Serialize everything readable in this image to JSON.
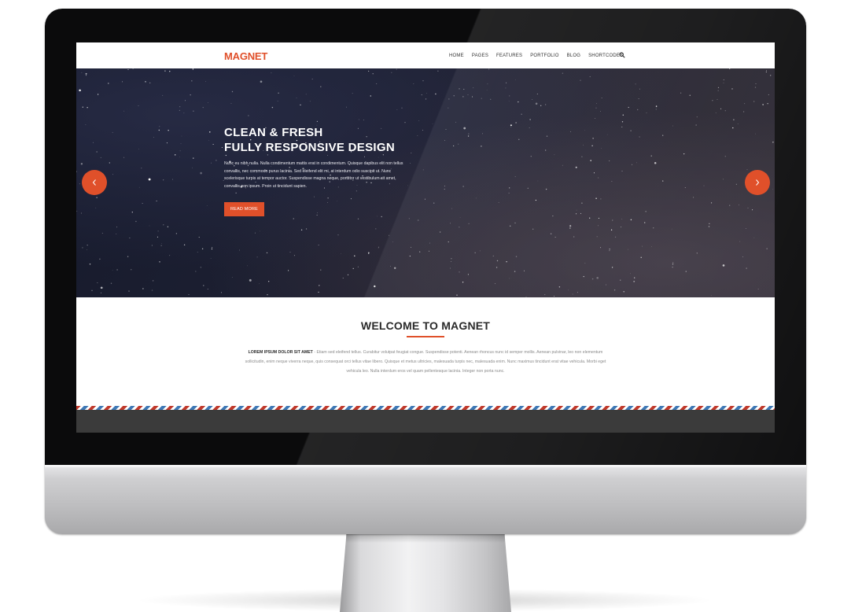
{
  "nav": {
    "logo": "MAGNET",
    "items": [
      "HOME",
      "PAGES",
      "FEATURES",
      "PORTFOLIO",
      "BLOG",
      "SHORTCODES"
    ],
    "search_icon": "search-icon"
  },
  "hero": {
    "title_line1": "CLEAN & FRESH",
    "title_line2": "FULLY RESPONSIVE DESIGN",
    "text": "Nunc eu nibh nulla. Nulla condimentum mattis erat in condimentum. Quisque dapibus elit non tellus convallis, nec commodo purus lacinia. Sed eleifend elit mi, at interdum odio suscipit ut. Nunc scelerisque turpis at tempor auctor. Suspendisse magna neque, porttitor ut vestibulum sit amet, convallis non ipsum. Proin ut tincidunt sapien.",
    "button": "READ MORE",
    "prev_icon": "chevron-left-icon",
    "next_icon": "chevron-right-icon"
  },
  "welcome": {
    "title": "WELCOME TO MAGNET",
    "lead": "LOREM IPSUM DOLOR SIT AMET",
    "separator": " - ",
    "body": "Etiam sed eleifend tellus. Curabitur volutpat feugiat congue. Suspendisse potenti. Aenean rhoncus nunc id semper mollis. Aenean pulvinar, leo non elementum sollicitudin, enim neque viverra neque, quis consequat orci tellus vitae libero. Quisque et metus ultricies, malesuada turpis nec, malesuada enim. Nunc maximus tincidunt erat vitae vehicula. Morbi eget vehicula leo. Nulla interdum eros vel quam pellentesque lacinia. Integer non porta nunc."
  },
  "colors": {
    "accent": "#e0502a",
    "nav_text": "#333333",
    "footer": "#3b3b3b",
    "airmail_red": "#c0392b",
    "airmail_blue": "#3f78b5"
  }
}
